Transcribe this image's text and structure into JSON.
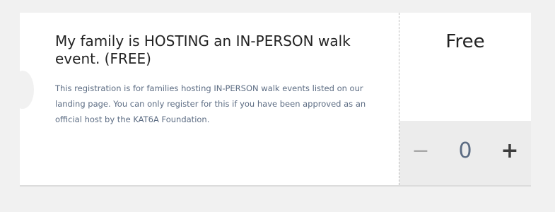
{
  "ticket": {
    "title": "My family is HOSTING an IN-PERSON walk event. (FREE)",
    "description": "This registration is for families hosting IN-PERSON walk events listed on our landing page. You can only register for this if you have been approved as an official host by the KAT6A Foundation.",
    "price": "Free",
    "quantity": {
      "value": "0",
      "decrement_label": "−",
      "increment_label": "+"
    }
  },
  "colors": {
    "page_background": "#f1f1f1",
    "card_background": "#ffffff",
    "description_text": "#5c6c83",
    "quantity_background": "#ececec",
    "title_text": "#222222"
  },
  "icons": {
    "decrement": "minus-icon",
    "increment": "plus-icon"
  }
}
